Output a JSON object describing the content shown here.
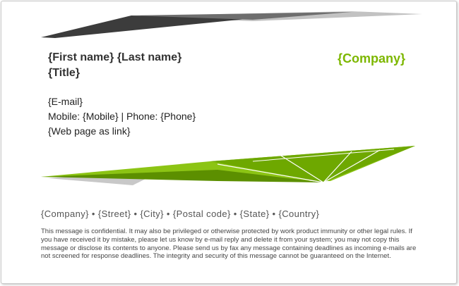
{
  "signature": {
    "name": "{First name} {Last name}",
    "title": "{Title}",
    "company": "{Company}",
    "email": "{E-mail}",
    "phone_line": "Mobile: {Mobile} | Phone: {Phone}",
    "web": "{Web page as link}"
  },
  "footer": {
    "address": "{Company} • {Street} • {City} • {Postal code} • {State} • {Country}",
    "disclaimer": "This message is confidential. It may also be privileged or otherwise protected by work product immunity or other legal rules. If you have received it by mistake, please let us know by e-mail reply and delete it from your system; you may not copy this message or disclose its contents to anyone. Please send us by fax any message containing deadlines as incoming e-mails are not screened for response deadlines. The integrity and security of this message cannot be guaranteed on the Internet."
  },
  "colors": {
    "accent_green": "#7db700",
    "dark_green": "#5a8a00",
    "dark_gray": "#3a3a3a",
    "light_gray": "#bdbdbd",
    "text": "#333333"
  }
}
